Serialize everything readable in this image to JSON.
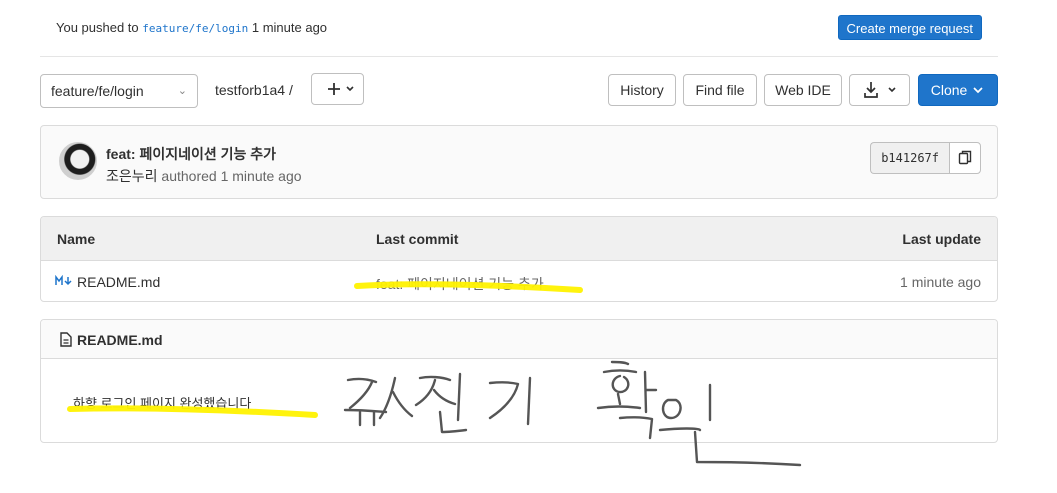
{
  "push_banner": {
    "prefix": "You pushed to",
    "branch": "feature/fe/login",
    "suffix": "1 minute ago",
    "create_mr_label": "Create merge request"
  },
  "toolbar": {
    "branch": "feature/fe/login",
    "repo_path": "testforb1a4  /",
    "history_label": "History",
    "find_file_label": "Find file",
    "web_ide_label": "Web IDE",
    "clone_label": "Clone"
  },
  "commit": {
    "title": "feat: 페이지네이션 기능 추가",
    "author": "조은누리",
    "meta": "authored 1 minute ago",
    "sha": "b141267f"
  },
  "file_table": {
    "headers": {
      "name": "Name",
      "last_commit": "Last commit",
      "last_update": "Last update"
    },
    "rows": [
      {
        "name": "README.md",
        "last_commit": "feat: 페이지네이션 기능 추가",
        "last_update": "1 minute ago"
      }
    ]
  },
  "readme": {
    "title": "README.md",
    "body": "하향 로그인 페이지 완성했습니다"
  },
  "colors": {
    "accent": "#1f75cb",
    "highlighter": "#fff200",
    "handwriting": "#555555"
  }
}
